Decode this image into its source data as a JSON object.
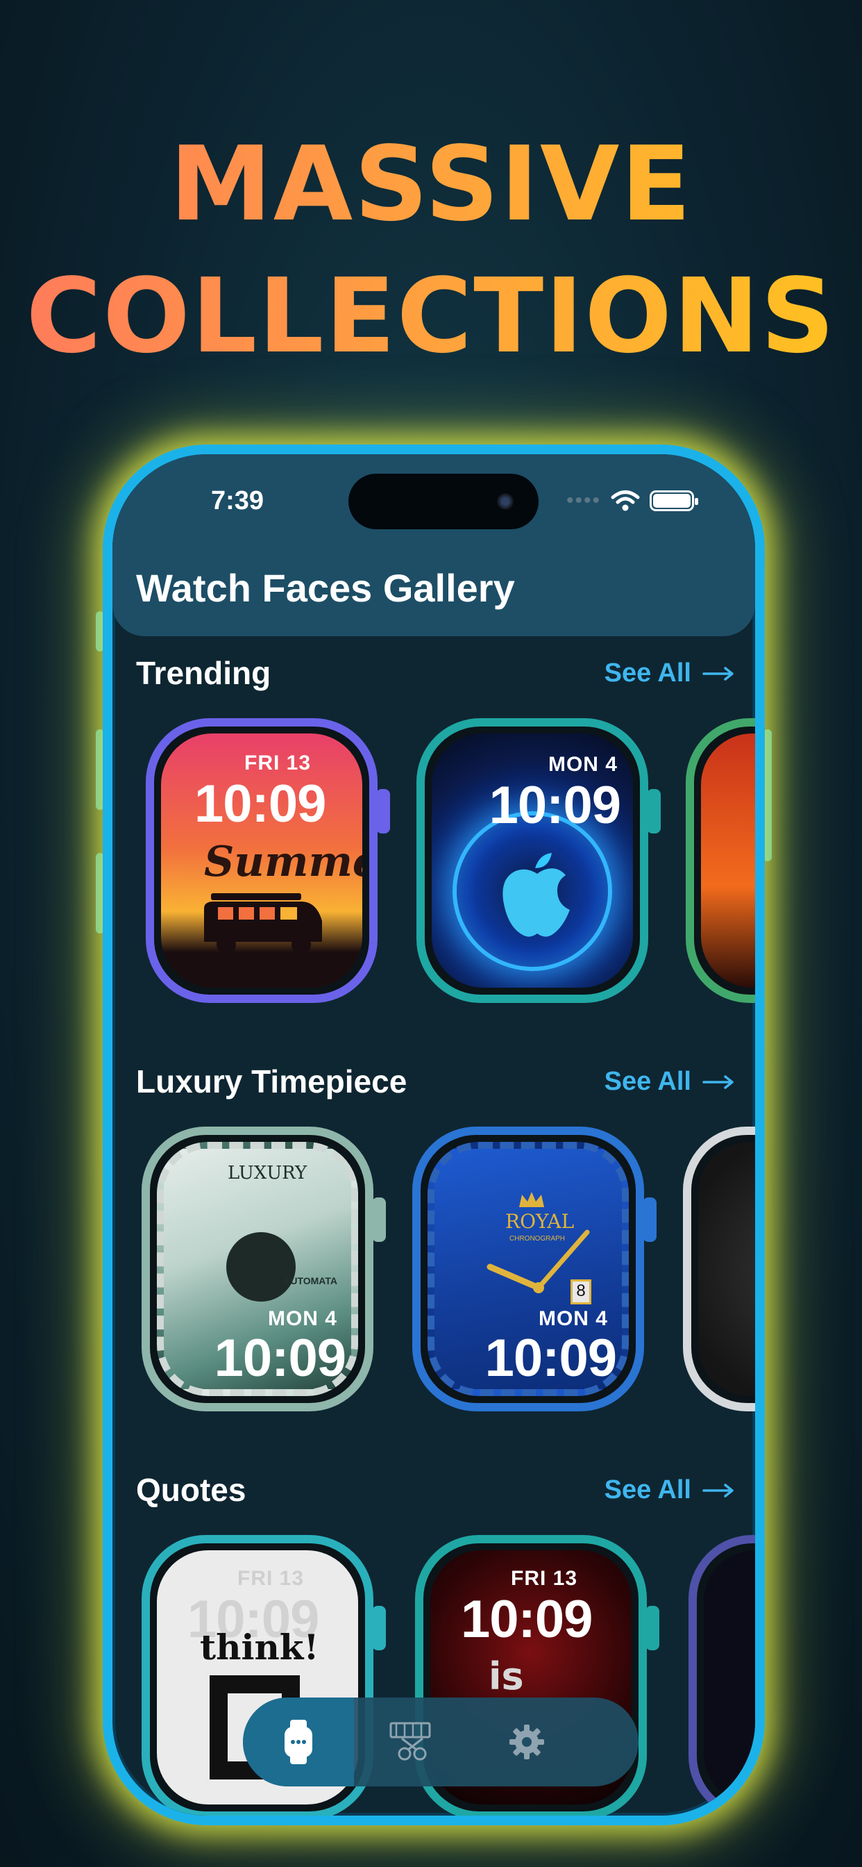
{
  "headline": {
    "line1": "MASSIVE",
    "line2": "COLLECTIONS"
  },
  "status_bar": {
    "time": "7:39"
  },
  "header": {
    "title": "Watch Faces Gallery"
  },
  "sections": [
    {
      "title": "Trending",
      "see_all": "See All"
    },
    {
      "title": "Luxury Timepiece",
      "see_all": "See All"
    },
    {
      "title": "Quotes",
      "see_all": "See All"
    }
  ],
  "faces": {
    "summer": {
      "date": "FRI 13",
      "time": "10:09",
      "text": "Summer"
    },
    "apple": {
      "date": "MON 4",
      "time": "10:09"
    },
    "luxury": {
      "date": "MON 4",
      "time": "10:09",
      "brand": "LUXURY",
      "sub": "AUTOMATA"
    },
    "royal": {
      "date": "MON 4",
      "time": "10:09",
      "brand": "ROYAL",
      "sub": "CHRONOGRAPH",
      "day": "8"
    },
    "think": {
      "date": "FRI 13",
      "time": "10:09",
      "text": "think!"
    },
    "life": {
      "date": "FRI 13",
      "time": "10:09",
      "text": "is"
    }
  },
  "tabs": [
    {
      "icon": "watch-icon",
      "active": true
    },
    {
      "icon": "film-edit-icon",
      "active": false
    },
    {
      "icon": "gear-icon",
      "active": false
    }
  ],
  "colors": {
    "accent": "#3fb6ee",
    "phone_frame": "#1bb2ea",
    "glow": "#e1eb46"
  }
}
